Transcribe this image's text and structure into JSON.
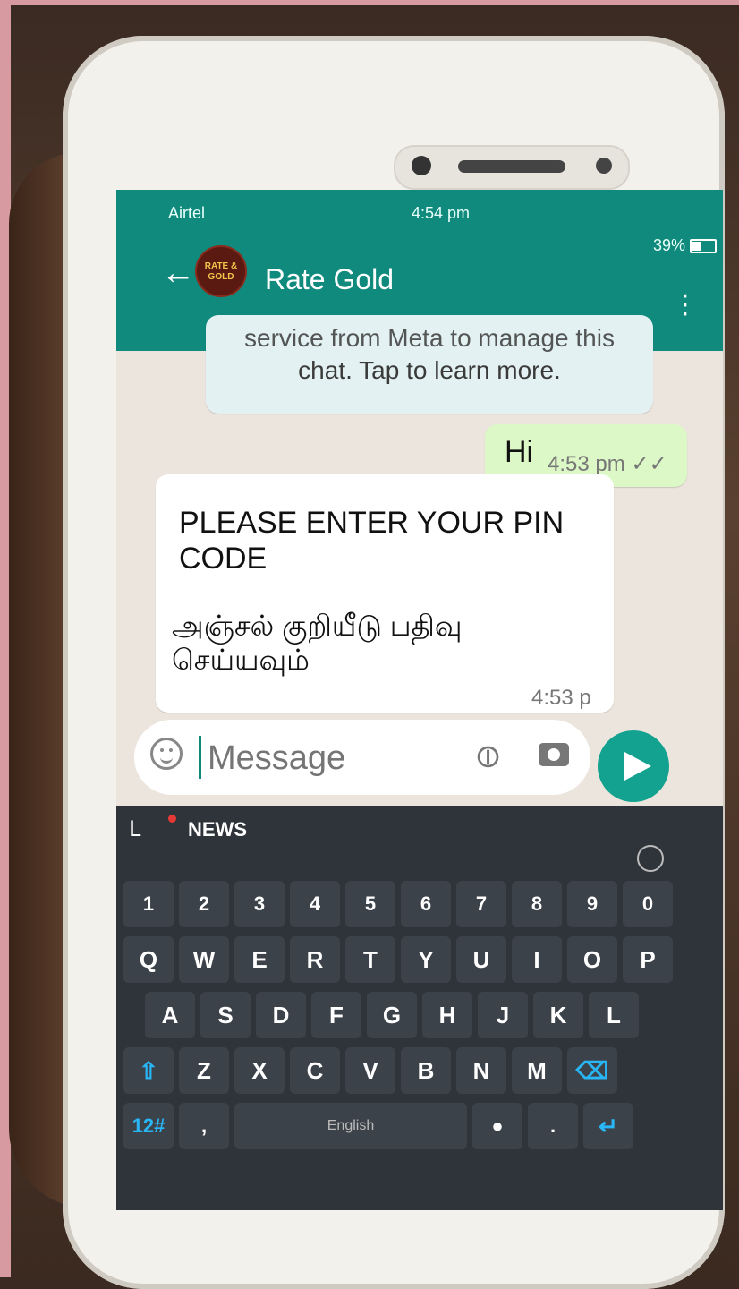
{
  "status_bar": {
    "carrier": "Airtel",
    "time": "4:54 pm",
    "battery": "39%"
  },
  "header": {
    "avatar_text": "RATE & GOLD",
    "title": "Rate Gold"
  },
  "messages": {
    "system_line1": "service from Meta to manage this",
    "system_line2": "chat. Tap to learn more.",
    "outgoing_text": "Hi",
    "outgoing_time": "4:53 pm",
    "incoming_line1": "PLEASE ENTER YOUR PIN CODE",
    "incoming_line2": "அஞ்சல் குறியீடு பதிவு செய்யவும்",
    "incoming_time": "4:53 p"
  },
  "composer": {
    "placeholder": "Message"
  },
  "keyboard": {
    "news_label": "NEWS",
    "numbers": [
      "1",
      "2",
      "3",
      "4",
      "5",
      "6",
      "7",
      "8",
      "9",
      "0"
    ],
    "row_q": [
      "Q",
      "W",
      "E",
      "R",
      "T",
      "Y",
      "U",
      "I",
      "O",
      "P"
    ],
    "row_a": [
      "A",
      "S",
      "D",
      "F",
      "G",
      "H",
      "J",
      "K",
      "L"
    ],
    "row_z": [
      "Z",
      "X",
      "C",
      "V",
      "B",
      "N",
      "M"
    ],
    "mode_key": "12#",
    "space_label": "English"
  },
  "colors": {
    "header": "#0f8a7d",
    "send": "#12a28f",
    "outgoing_bubble": "#dcf8c6"
  }
}
